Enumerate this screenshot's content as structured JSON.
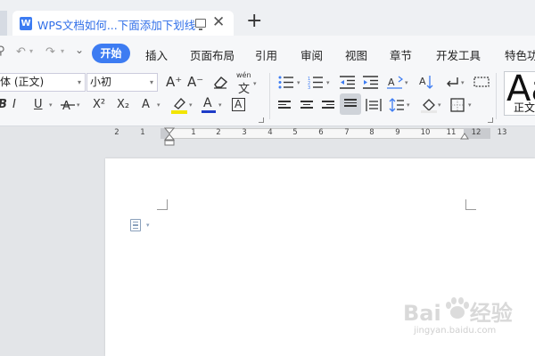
{
  "tab": {
    "icon_letter": "W",
    "title": "WPS文档如何...下面添加下划线",
    "new_tab": "+"
  },
  "quick_access": {
    "search": "⚲",
    "undo": "↶",
    "redo": "↷",
    "customize": "⌄"
  },
  "menu": {
    "home": "开始",
    "items": [
      "插入",
      "页面布局",
      "引用",
      "审阅",
      "视图",
      "章节",
      "开发工具",
      "特色功"
    ]
  },
  "font": {
    "name": "体 (正文)",
    "size": "小初"
  },
  "ribbon_text": {
    "grow_font": "A⁺",
    "shrink_font": "A⁻",
    "phonetic": "wén",
    "phonetic_char": "文",
    "bold": "B",
    "italic": "I",
    "underline": "U",
    "superscript": "X²",
    "subscript": "X₂",
    "text_effect": "A",
    "char_border": "A",
    "font_color": "A",
    "highlight": "ab"
  },
  "style_preview": {
    "big": "Aa",
    "small": "正文"
  },
  "ruler": {
    "ticks": [
      "2",
      "1",
      "1",
      "2",
      "3",
      "4",
      "5",
      "6",
      "7",
      "8",
      "9",
      "10",
      "11",
      "12",
      "13"
    ]
  },
  "watermark": {
    "logo_left": "Bai",
    "logo_right": "经验",
    "url": "jingyan.baidu.com"
  },
  "colors": {
    "accent": "#3d7cf2",
    "font_color_bar": "#1e3cc8",
    "highlight_bar": "#f2e500"
  }
}
